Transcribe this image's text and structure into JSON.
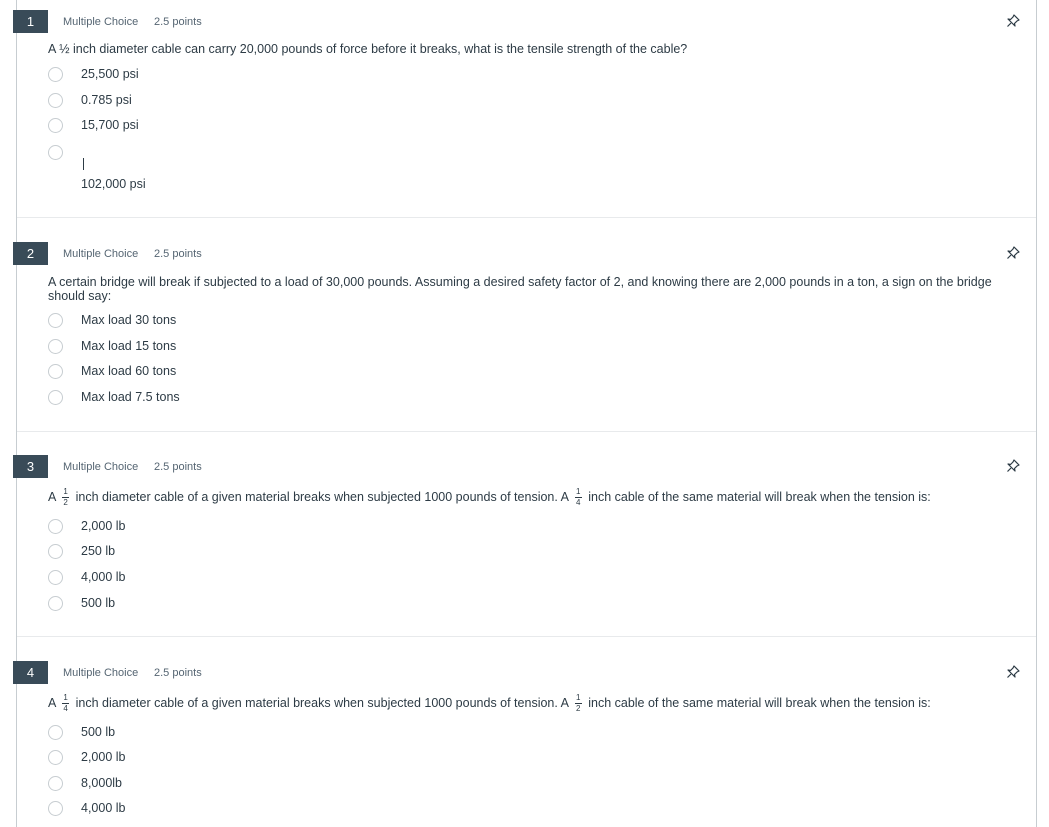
{
  "questions": [
    {
      "number": "1",
      "type": "Multiple Choice",
      "points": "2.5 points",
      "text": "A ½ inch diameter cable can carry 20,000 pounds of force before it breaks, what is the tensile strength of the cable?",
      "answers": [
        "25,500 psi",
        "0.785 psi",
        "15,700 psi",
        "102,000 psi"
      ]
    },
    {
      "number": "2",
      "type": "Multiple Choice",
      "points": "2.5 points",
      "text": "A certain bridge will break if subjected to a load of 30,000 pounds.  Assuming a desired safety factor of 2, and knowing there are 2,000 pounds in a ton, a sign on the bridge should say:",
      "answers": [
        "Max load 30 tons",
        "Max load 15 tons",
        "Max load 60 tons",
        "Max load 7.5 tons"
      ]
    },
    {
      "number": "3",
      "type": "Multiple Choice",
      "points": "2.5 points",
      "text_parts": [
        "A",
        "inch diameter cable of a given material breaks when subjected 1000 pounds of tension.  A",
        "inch cable of the same material will break when the tension is:"
      ],
      "fractions": [
        {
          "num": "1",
          "den": "2"
        },
        {
          "num": "1",
          "den": "4"
        }
      ],
      "answers": [
        "2,000 lb",
        "250 lb",
        "4,000 lb",
        "500 lb"
      ]
    },
    {
      "number": "4",
      "type": "Multiple Choice",
      "points": "2.5 points",
      "text_parts": [
        "A",
        "inch diameter cable of a given material breaks when subjected 1000 pounds of tension.  A",
        "inch cable of the same material will break when the tension is:"
      ],
      "fractions": [
        {
          "num": "1",
          "den": "4"
        },
        {
          "num": "1",
          "den": "2"
        }
      ],
      "answers": [
        "500 lb",
        "2,000 lb",
        "8,000lb",
        "4,000 lb"
      ]
    }
  ],
  "icons": {
    "pin": "pin-icon"
  },
  "colors": {
    "number_badge": "#394b58",
    "text": "#2d3b45",
    "border": "#c7cdd1"
  }
}
